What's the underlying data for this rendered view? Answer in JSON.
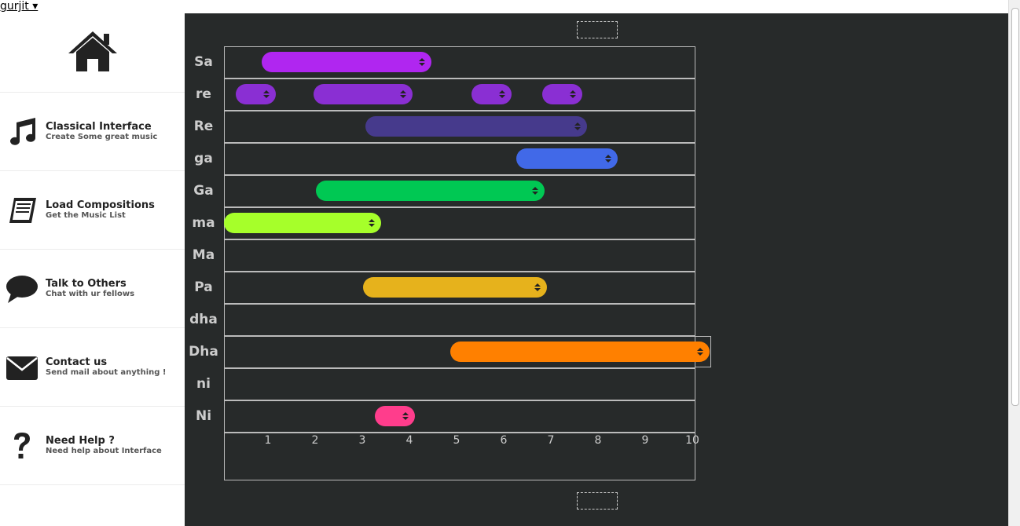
{
  "user": {
    "name": "gurjit ▾"
  },
  "sidebar": {
    "home_icon": "home-icon",
    "items": [
      {
        "title": "Classical Interface",
        "subtitle": "Create Some great music",
        "icon": "music-note-icon"
      },
      {
        "title": "Load Compositions",
        "subtitle": "Get the Music List",
        "icon": "book-icon"
      },
      {
        "title": "Talk to Others",
        "subtitle": "Chat with ur fellows",
        "icon": "chat-bubble-icon"
      },
      {
        "title": "Contact us",
        "subtitle": "Send mail about anything !",
        "icon": "envelope-icon"
      },
      {
        "title": "Need Help ?",
        "subtitle": "Need help about Interface",
        "icon": "question-icon"
      }
    ]
  },
  "composer": {
    "notes": [
      "Sa",
      "re",
      "Re",
      "ga",
      "Ga",
      "ma",
      "Ma",
      "Pa",
      "dha",
      "Dha",
      "ni",
      "Ni"
    ],
    "x_ticks": [
      "1",
      "2",
      "3",
      "4",
      "5",
      "6",
      "7",
      "8",
      "9",
      "10"
    ],
    "x_range": [
      0,
      10
    ],
    "bars": [
      {
        "note": "Sa",
        "start": 0.8,
        "end": 4.4,
        "color": "#b026f0"
      },
      {
        "note": "re",
        "start": 0.25,
        "end": 1.1,
        "color": "#8a2fd3"
      },
      {
        "note": "re",
        "start": 1.9,
        "end": 4.0,
        "color": "#8a2fd3"
      },
      {
        "note": "re",
        "start": 5.25,
        "end": 6.1,
        "color": "#8a2fd3"
      },
      {
        "note": "re",
        "start": 6.75,
        "end": 7.6,
        "color": "#8a2fd3"
      },
      {
        "note": "Re",
        "start": 3.0,
        "end": 7.7,
        "color": "#463a8c"
      },
      {
        "note": "ga",
        "start": 6.2,
        "end": 8.35,
        "color": "#4169e8"
      },
      {
        "note": "Ga",
        "start": 1.95,
        "end": 6.8,
        "color": "#00c853"
      },
      {
        "note": "ma",
        "start": 0.0,
        "end": 3.33,
        "color": "#a6ff2a"
      },
      {
        "note": "Pa",
        "start": 2.95,
        "end": 6.85,
        "color": "#e6b21c"
      },
      {
        "note": "Dha",
        "start": 4.8,
        "end": 10.3,
        "color": "#ff8000"
      },
      {
        "note": "Ni",
        "start": 3.2,
        "end": 4.05,
        "color": "#ff3d8c"
      }
    ]
  }
}
